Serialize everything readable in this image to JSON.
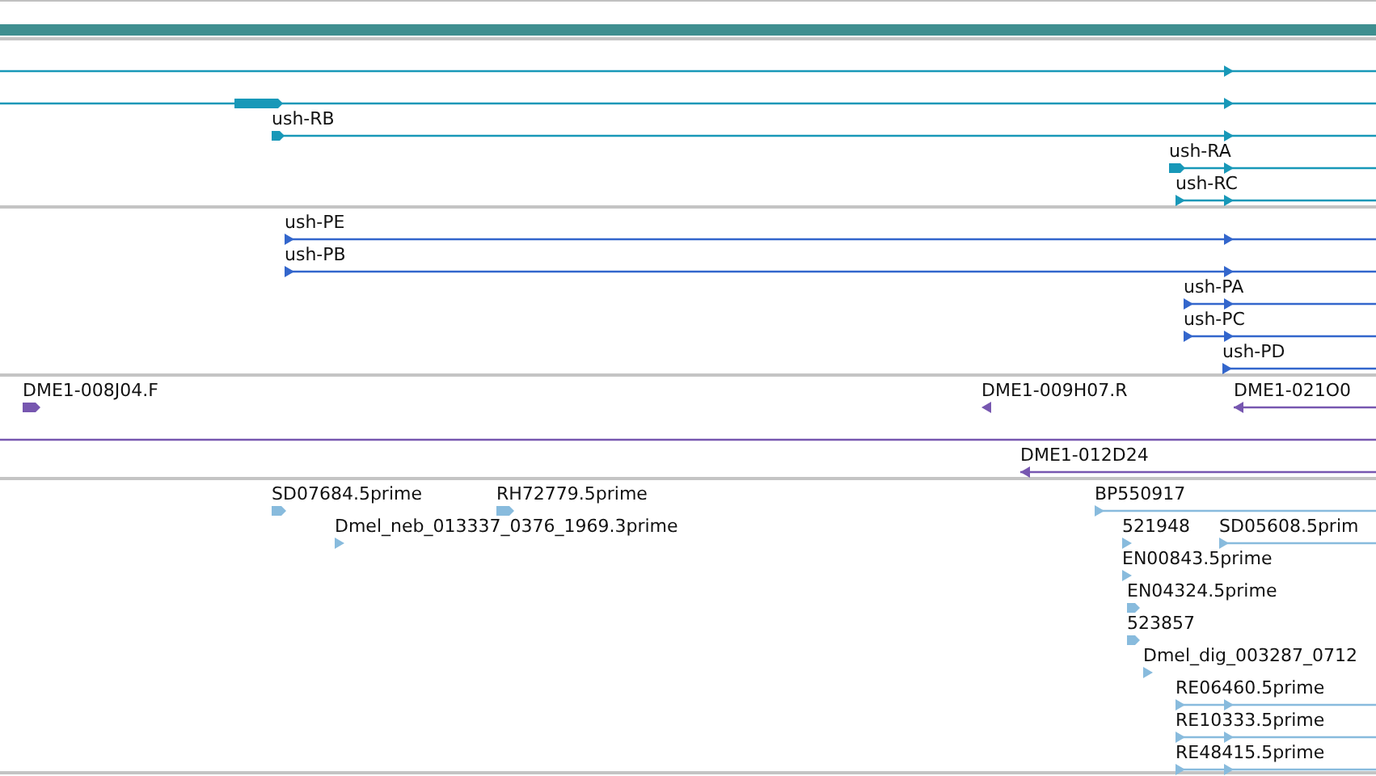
{
  "tracks": [
    {
      "kind": "scale",
      "color": "#3f8f90"
    },
    {
      "kind": "features",
      "color": "#1898b8",
      "features": [
        {
          "kind": "transcript"
        },
        {
          "kind": "transcript"
        },
        {
          "kind": "transcript",
          "label": "ush-RB"
        },
        {
          "kind": "transcript",
          "label": "ush-RA"
        },
        {
          "kind": "transcript",
          "label": "ush-RC"
        }
      ]
    },
    {
      "kind": "features",
      "color": "#3366cc",
      "features": [
        {
          "kind": "transcript",
          "label": "ush-PE"
        },
        {
          "kind": "transcript",
          "label": "ush-PB"
        },
        {
          "kind": "transcript",
          "label": "ush-PA"
        },
        {
          "kind": "transcript",
          "label": "ush-PC"
        },
        {
          "kind": "transcript",
          "label": "ush-PD"
        }
      ]
    },
    {
      "kind": "features",
      "color": "#7757b0",
      "features": [
        {
          "kind": "block",
          "label": "DME1-008J04.F"
        },
        {
          "kind": "arrow",
          "label": "DME1-009H07.R"
        },
        {
          "kind": "transcript",
          "label": "DME1-021O0"
        },
        {
          "kind": "transcript"
        },
        {
          "kind": "transcript",
          "label": "DME1-012D24"
        }
      ]
    },
    {
      "kind": "features",
      "color": "#88bbdd",
      "features": [
        {
          "kind": "block",
          "label": "SD07684.5prime"
        },
        {
          "kind": "block",
          "label": "RH72779.5prime"
        },
        {
          "kind": "arrow",
          "label": "Dmel_neb_013337_0376_1969.3prime"
        },
        {
          "kind": "transcript",
          "label": "BP550917"
        },
        {
          "kind": "arrow",
          "label": "521948"
        },
        {
          "kind": "transcript",
          "label": "SD05608.5prim"
        },
        {
          "kind": "arrow",
          "label": "EN00843.5prime"
        },
        {
          "kind": "block",
          "label": "EN04324.5prime"
        },
        {
          "kind": "block",
          "label": "523857"
        },
        {
          "kind": "arrow",
          "label": "Dmel_dig_003287_0712"
        },
        {
          "kind": "transcript",
          "label": "RE06460.5prime"
        },
        {
          "kind": "transcript",
          "label": "RE10333.5prime"
        },
        {
          "kind": "transcript",
          "label": "RE48415.5prime"
        }
      ]
    }
  ]
}
